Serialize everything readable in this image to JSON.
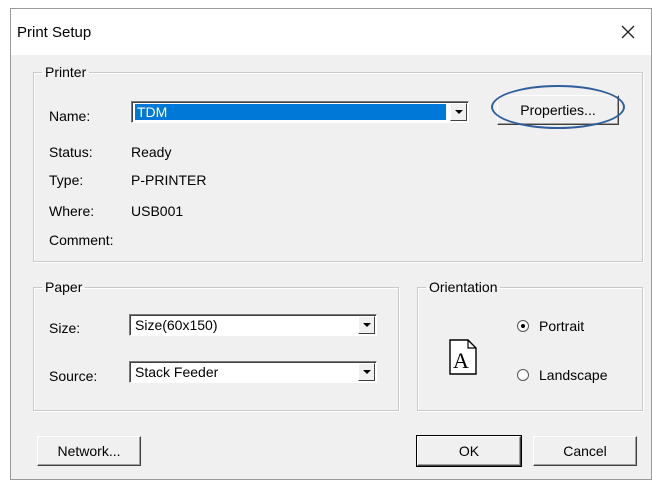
{
  "dialog": {
    "title": "Print Setup"
  },
  "printer": {
    "group_label": "Printer",
    "name_label": "Name:",
    "name_value": "TDM",
    "properties_button": "Properties...",
    "status_label": "Status:",
    "status_value": "Ready",
    "type_label": "Type:",
    "type_value": "P-PRINTER",
    "where_label": "Where:",
    "where_value": "USB001",
    "comment_label": "Comment:",
    "comment_value": ""
  },
  "paper": {
    "group_label": "Paper",
    "size_label": "Size:",
    "size_value": "Size(60x150)",
    "source_label": "Source:",
    "source_value": "Stack Feeder"
  },
  "orientation": {
    "group_label": "Orientation",
    "portrait_label": "Portrait",
    "landscape_label": "Landscape",
    "selected": "Portrait",
    "icon_letter": "A"
  },
  "buttons": {
    "network": "Network...",
    "ok": "OK",
    "cancel": "Cancel"
  },
  "icons": {
    "close": "close-icon",
    "dropdown": "chevron-down-icon",
    "page": "document-portrait-icon"
  },
  "colors": {
    "selection": "#0078d7",
    "annotation_oval": "#2e5e9c"
  }
}
